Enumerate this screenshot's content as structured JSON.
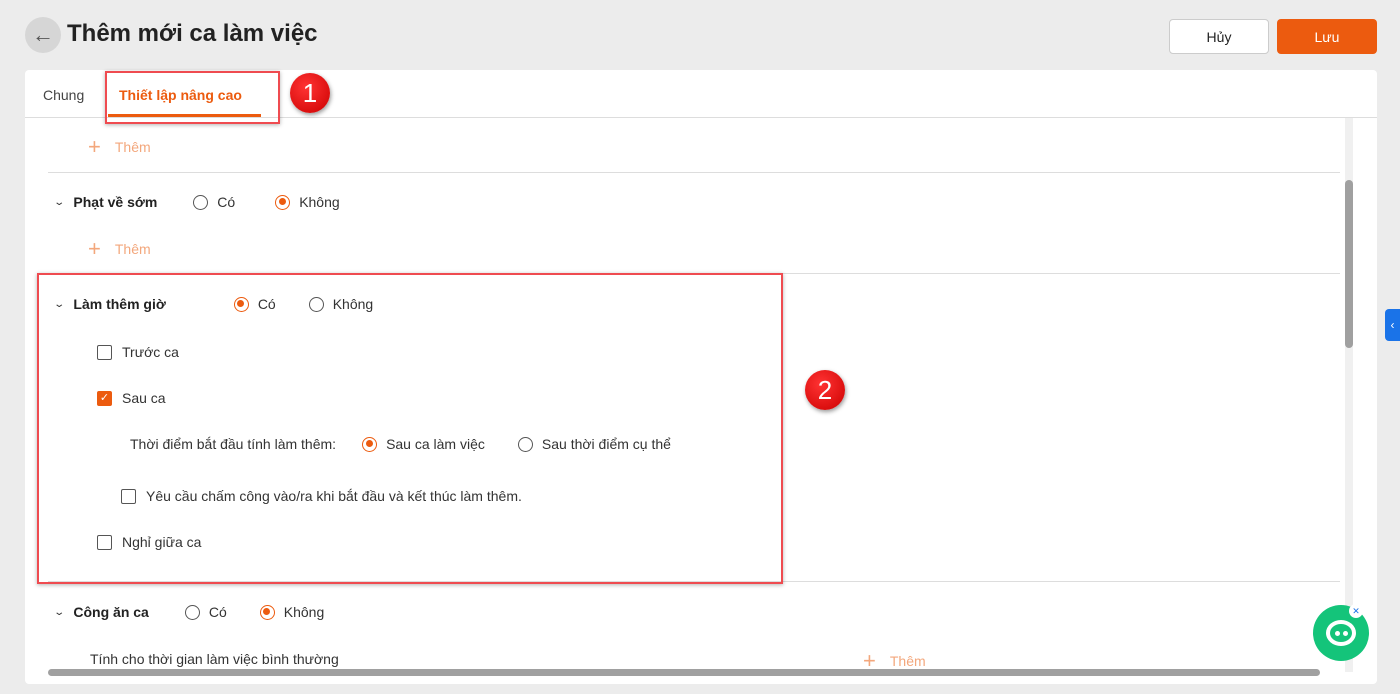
{
  "header": {
    "title": "Thêm mới ca làm việc",
    "back_icon": "←",
    "cancel": "Hủy",
    "save": "Lưu"
  },
  "tabs": [
    {
      "label": "Chung"
    },
    {
      "label": "Thiết lập nâng cao"
    }
  ],
  "add_label": "Thêm",
  "early_leave": {
    "label": "Phạt về sớm",
    "yes": "Có",
    "no": "Không",
    "selected": "no"
  },
  "overtime": {
    "label": "Làm thêm giờ",
    "yes": "Có",
    "no": "Không",
    "selected": "yes",
    "before": "Trước ca",
    "after": "Sau ca",
    "start_label": "Thời điểm bắt đầu tính làm thêm:",
    "opt_after_shift": "Sau ca làm việc",
    "opt_specific": "Sau thời điểm cụ thể",
    "require_checkin": "Yêu cầu chấm công vào/ra khi bắt đầu và kết thúc làm thêm.",
    "break": "Nghỉ giữa ca"
  },
  "meal": {
    "label": "Công ăn ca",
    "yes": "Có",
    "no": "Không",
    "selected": "no",
    "normal_time": "Tính cho thời gian làm việc bình thường"
  },
  "annotations": [
    "1",
    "2"
  ],
  "colors": {
    "accent": "#ec5b0f",
    "annotation": "#ef4b50"
  }
}
